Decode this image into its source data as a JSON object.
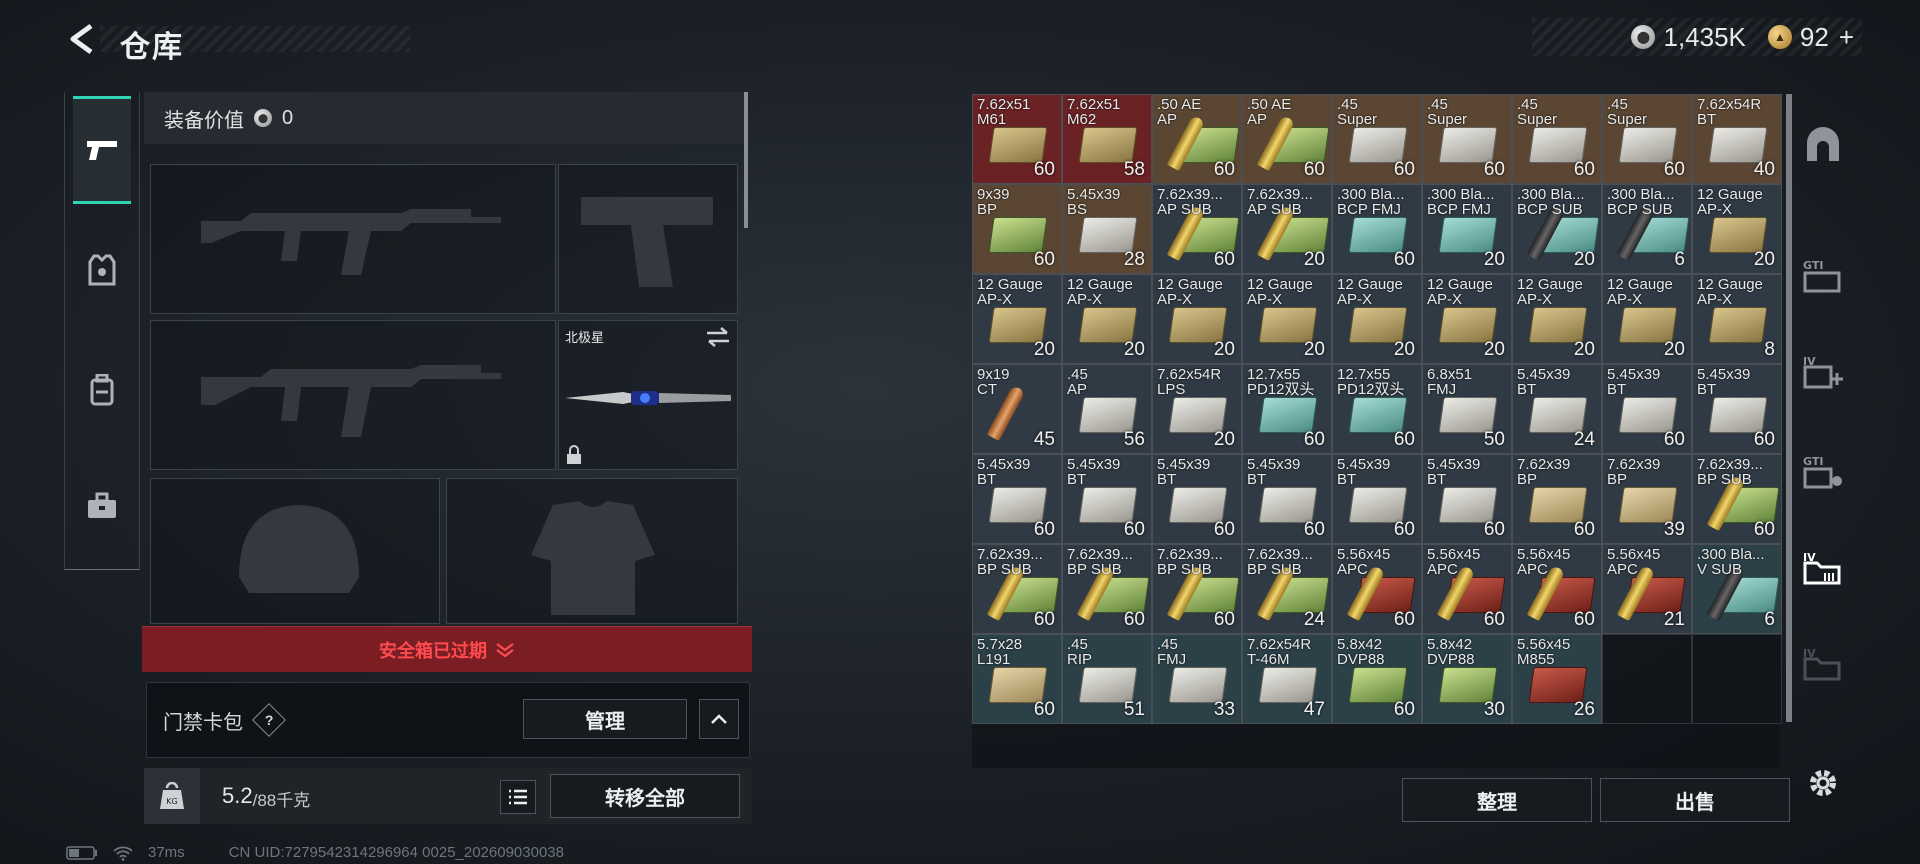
{
  "header": {
    "title": "仓库"
  },
  "currency": {
    "silver": "1,435K",
    "gold": "92",
    "gold_suffix": "+"
  },
  "equipment": {
    "value_label": "装备价值",
    "value": "0",
    "knife_name": "北极星"
  },
  "alert": {
    "text": "安全箱已过期"
  },
  "card_pack": {
    "label": "门禁卡包",
    "help": "?",
    "manage_label": "管理"
  },
  "weight": {
    "current": "5.2",
    "max": "/88千克"
  },
  "transfer_all_label": "转移全部",
  "actions": {
    "organize_label": "整理",
    "sell_label": "出售"
  },
  "status": {
    "ping": "37ms",
    "uid": "CN UID:7279542314296964 0025_202609030038"
  },
  "colors": {
    "accent": "#2fd3b5",
    "alert_bg": "#7a1e24",
    "alert_text": "#ff4b50"
  },
  "inventory": [
    {
      "label": "7.62x51\nM61",
      "count": "60",
      "bg": "#6b2224",
      "icon": "gold"
    },
    {
      "label": "7.62x51\nM62",
      "count": "58",
      "bg": "#6b2224",
      "icon": "gold"
    },
    {
      "label": ".50 AE\nAP",
      "count": "60",
      "bg": "#5a4632",
      "icon": "bullet"
    },
    {
      "label": ".50 AE\nAP",
      "count": "60",
      "bg": "#5a4632",
      "icon": "bullet"
    },
    {
      "label": ".45\nSuper",
      "count": "60",
      "bg": "#5a4632",
      "icon": "white"
    },
    {
      "label": ".45\nSuper",
      "count": "60",
      "bg": "#5a4632",
      "icon": "white"
    },
    {
      "label": ".45\nSuper",
      "count": "60",
      "bg": "#5a4632",
      "icon": "white"
    },
    {
      "label": ".45\nSuper",
      "count": "60",
      "bg": "#5a4632",
      "icon": "white"
    },
    {
      "label": "7.62x54R\nBT",
      "count": "40",
      "bg": "#5a4632",
      "icon": "white"
    },
    {
      "label": "9x39\nBP",
      "count": "60",
      "bg": "#5a4632",
      "icon": "green"
    },
    {
      "label": "5.45x39\nBS",
      "count": "28",
      "bg": "#5a4632",
      "icon": "white"
    },
    {
      "label": "7.62x39...\nAP SUB",
      "count": "60",
      "bg": "#303a44",
      "icon": "bullet"
    },
    {
      "label": "7.62x39...\nAP SUB",
      "count": "20",
      "bg": "#303a44",
      "icon": "bullet"
    },
    {
      "label": ".300 Bla...\nBCP FMJ",
      "count": "60",
      "bg": "#303a44",
      "icon": "teal"
    },
    {
      "label": ".300 Bla...\nBCP FMJ",
      "count": "20",
      "bg": "#303a44",
      "icon": "teal"
    },
    {
      "label": ".300 Bla...\nBCP SUB",
      "count": "20",
      "bg": "#303a44",
      "icon": "bulletblack"
    },
    {
      "label": ".300 Bla...\nBCP SUB",
      "count": "6",
      "bg": "#303a44",
      "icon": "bulletblack"
    },
    {
      "label": "12 Gauge\nAP-X",
      "count": "20",
      "bg": "#303a44",
      "icon": "gold"
    },
    {
      "label": "12 Gauge\nAP-X",
      "count": "20",
      "bg": "#303a44",
      "icon": "gold"
    },
    {
      "label": "12 Gauge\nAP-X",
      "count": "20",
      "bg": "#303a44",
      "icon": "gold"
    },
    {
      "label": "12 Gauge\nAP-X",
      "count": "20",
      "bg": "#303a44",
      "icon": "gold"
    },
    {
      "label": "12 Gauge\nAP-X",
      "count": "20",
      "bg": "#303a44",
      "icon": "gold"
    },
    {
      "label": "12 Gauge\nAP-X",
      "count": "20",
      "bg": "#303a44",
      "icon": "gold"
    },
    {
      "label": "12 Gauge\nAP-X",
      "count": "20",
      "bg": "#303a44",
      "icon": "gold"
    },
    {
      "label": "12 Gauge\nAP-X",
      "count": "20",
      "bg": "#303a44",
      "icon": "gold"
    },
    {
      "label": "12 Gauge\nAP-X",
      "count": "20",
      "bg": "#303a44",
      "icon": "gold"
    },
    {
      "label": "12 Gauge\nAP-X",
      "count": "8",
      "bg": "#303a44",
      "icon": "gold"
    },
    {
      "label": "9x19\nCT",
      "count": "45",
      "bg": "#303a44",
      "icon": "bulletcopper"
    },
    {
      "label": ".45\nAP",
      "count": "56",
      "bg": "#303a44",
      "icon": "white"
    },
    {
      "label": "7.62x54R\nLPS",
      "count": "20",
      "bg": "#303a44",
      "icon": "white"
    },
    {
      "label": "12.7x55\nPD12双头",
      "count": "60",
      "bg": "#303a44",
      "icon": "teal"
    },
    {
      "label": "12.7x55\nPD12双头",
      "count": "60",
      "bg": "#303a44",
      "icon": "teal"
    },
    {
      "label": "6.8x51\nFMJ",
      "count": "50",
      "bg": "#303a44",
      "icon": "white"
    },
    {
      "label": "5.45x39\nBT",
      "count": "24",
      "bg": "#303a44",
      "icon": "white"
    },
    {
      "label": "5.45x39\nBT",
      "count": "60",
      "bg": "#303a44",
      "icon": "white"
    },
    {
      "label": "5.45x39\nBT",
      "count": "60",
      "bg": "#303a44",
      "icon": "white"
    },
    {
      "label": "5.45x39\nBT",
      "count": "60",
      "bg": "#303a44",
      "icon": "white"
    },
    {
      "label": "5.45x39\nBT",
      "count": "60",
      "bg": "#303a44",
      "icon": "white"
    },
    {
      "label": "5.45x39\nBT",
      "count": "60",
      "bg": "#303a44",
      "icon": "white"
    },
    {
      "label": "5.45x39\nBT",
      "count": "60",
      "bg": "#303a44",
      "icon": "white"
    },
    {
      "label": "5.45x39\nBT",
      "count": "60",
      "bg": "#303a44",
      "icon": "white"
    },
    {
      "label": "5.45x39\nBT",
      "count": "60",
      "bg": "#303a44",
      "icon": "white"
    },
    {
      "label": "7.62x39\nBP",
      "count": "60",
      "bg": "#303a44",
      "icon": "tan"
    },
    {
      "label": "7.62x39\nBP",
      "count": "39",
      "bg": "#303a44",
      "icon": "tan"
    },
    {
      "label": "7.62x39...\nBP SUB",
      "count": "60",
      "bg": "#303a44",
      "icon": "bullet"
    },
    {
      "label": "7.62x39...\nBP SUB",
      "count": "60",
      "bg": "#303a44",
      "icon": "bullet"
    },
    {
      "label": "7.62x39...\nBP SUB",
      "count": "60",
      "bg": "#303a44",
      "icon": "bullet"
    },
    {
      "label": "7.62x39...\nBP SUB",
      "count": "60",
      "bg": "#303a44",
      "icon": "bullet"
    },
    {
      "label": "7.62x39...\nBP SUB",
      "count": "24",
      "bg": "#303a44",
      "icon": "bullet"
    },
    {
      "label": "5.56x45\nAPC",
      "count": "60",
      "bg": "#303a44",
      "icon": "redbullet"
    },
    {
      "label": "5.56x45\nAPC",
      "count": "60",
      "bg": "#303a44",
      "icon": "redbullet"
    },
    {
      "label": "5.56x45\nAPC",
      "count": "60",
      "bg": "#303a44",
      "icon": "redbullet"
    },
    {
      "label": "5.56x45\nAPC",
      "count": "21",
      "bg": "#303a44",
      "icon": "redbullet"
    },
    {
      "label": ".300 Bla...\nV SUB",
      "count": "6",
      "bg": "#2c4048",
      "icon": "bulletblack"
    },
    {
      "label": "5.7x28\nL191",
      "count": "60",
      "bg": "#2c4048",
      "icon": "tan"
    },
    {
      "label": ".45\nRIP",
      "count": "51",
      "bg": "#2c4048",
      "icon": "white"
    },
    {
      "label": ".45\nFMJ",
      "count": "33",
      "bg": "#2c4048",
      "icon": "white"
    },
    {
      "label": "7.62x54R\nT-46M",
      "count": "47",
      "bg": "#2c4048",
      "icon": "white"
    },
    {
      "label": "5.8x42\nDVP88",
      "count": "60",
      "bg": "#2c4048",
      "icon": "green"
    },
    {
      "label": "5.8x42\nDVP88",
      "count": "30",
      "bg": "#2c4048",
      "icon": "green"
    },
    {
      "label": "5.56x45\nM855",
      "count": "26",
      "bg": "#2c4048",
      "icon": "red"
    }
  ]
}
